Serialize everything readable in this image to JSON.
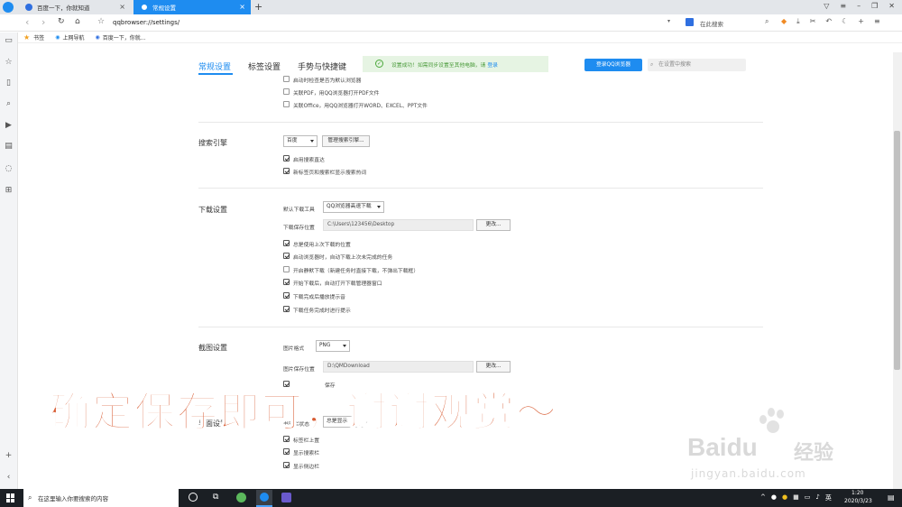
{
  "tabs": [
    {
      "label": "百度一下，你就知道"
    },
    {
      "label": "常规设置"
    }
  ],
  "address": {
    "url": "qqbrowser://settings/",
    "search_placeholder": "在此搜索"
  },
  "bookmarks": [
    {
      "label": "书签"
    },
    {
      "label": "上网导航"
    },
    {
      "label": "百度一下，你就..."
    }
  ],
  "settings": {
    "tabs": [
      "常规设置",
      "标签设置",
      "手势与快捷键"
    ],
    "notice": "设置成功！如需同步设置至其他电脑，请",
    "notice_link": "登录",
    "login_button": "登录QQ浏览器",
    "search_placeholder": "在设置中搜索"
  },
  "startup": {
    "items": [
      {
        "label": "启动时检查是否为默认浏览器",
        "checked": false
      },
      {
        "label": "关联PDF，用QQ浏览器打开PDF文件",
        "checked": false
      },
      {
        "label": "关联Office，用QQ浏览器打开WORD、EXCEL、PPT文件",
        "checked": false
      }
    ]
  },
  "search_engine": {
    "title": "搜索引擎",
    "engine": "百度",
    "manage_button": "管理搜索引擎...",
    "items": [
      {
        "label": "启用搜索直达",
        "checked": true
      },
      {
        "label": "新标签页和搜索栏显示搜索热词",
        "checked": true
      }
    ]
  },
  "download": {
    "title": "下载设置",
    "tool_label": "默认下载工具",
    "tool_value": "QQ浏览器高速下载",
    "path_label": "下载保存位置",
    "path_value": "C:\\Users\\123456\\Desktop",
    "change_button": "更改...",
    "items": [
      {
        "label": "总是使用上次下载的位置",
        "checked": true
      },
      {
        "label": "启动浏览器时，自动下载上次未完成的任务",
        "checked": true
      },
      {
        "label": "开启静默下载（新建任务时直接下载，不弹出下载框）",
        "checked": false
      },
      {
        "label": "开始下载后，自动打开下载管理器窗口",
        "checked": true
      },
      {
        "label": "下载完成后播放提示音",
        "checked": true
      },
      {
        "label": "下载任务完成时进行提示",
        "checked": true
      }
    ]
  },
  "screenshot": {
    "title": "截图设置",
    "format_label": "图片格式",
    "format_value": "PNG",
    "path_label": "图片保存位置",
    "path_value": "D:\\QMDownload",
    "change_button": "更改...",
    "partial_label": "保存"
  },
  "interface": {
    "title": "界面设置",
    "bar_label": "书签栏状态",
    "bar_value": "总是显示",
    "items": [
      {
        "label": "标签栏上置",
        "checked": true
      },
      {
        "label": "显示搜索栏",
        "checked": true
      },
      {
        "label": "显示侧边栏",
        "checked": true
      }
    ]
  },
  "overlay_caption": "确定保存即可，谢谢观赏～",
  "watermark": {
    "brand": "Baidu",
    "brand_cn": "经验",
    "url": "jingyan.baidu.com"
  },
  "taskbar": {
    "search_placeholder": "在这里输入你要搜索的内容",
    "time": "1:20",
    "date": "2020/3/23"
  },
  "colors": {
    "accent": "#1e8cf0",
    "caption": "#d85c33",
    "notice_bg": "#e6f4e3"
  }
}
